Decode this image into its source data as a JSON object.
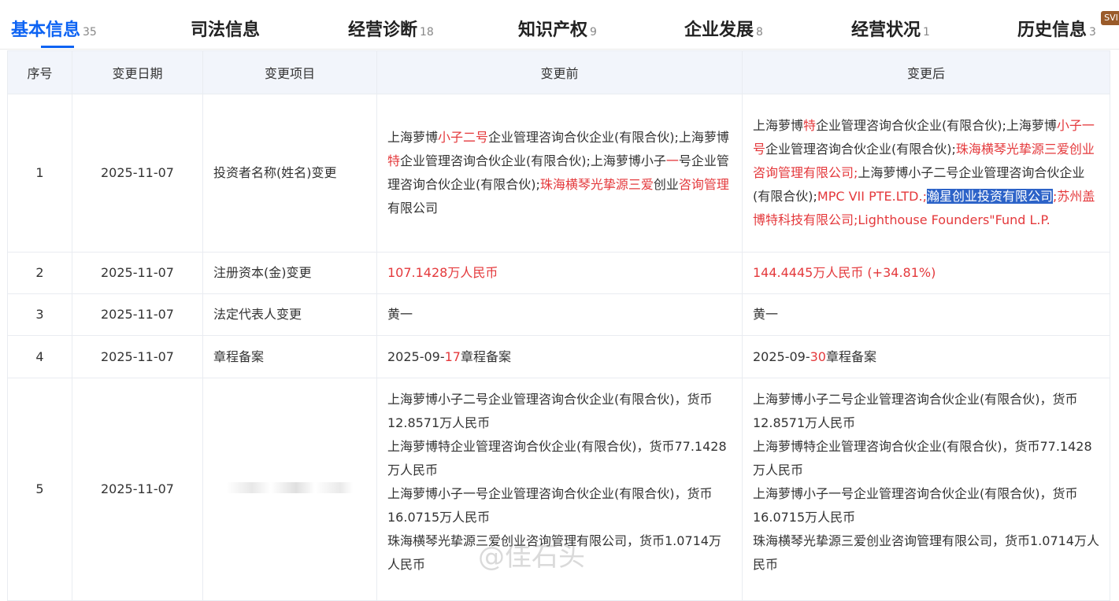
{
  "tabs": [
    {
      "label": "基本信息",
      "count": "35"
    },
    {
      "label": "司法信息",
      "count": ""
    },
    {
      "label": "经营诊断",
      "count": "18"
    },
    {
      "label": "知识产权",
      "count": "9"
    },
    {
      "label": "企业发展",
      "count": "8"
    },
    {
      "label": "经营状况",
      "count": "1"
    },
    {
      "label": "历史信息",
      "count": "3"
    }
  ],
  "badge": "SVI",
  "table": {
    "headers": [
      "序号",
      "变更日期",
      "变更项目",
      "变更前",
      "变更后"
    ],
    "rows": [
      {
        "index": "1",
        "date": "2025-11-07",
        "item": "投资者名称(姓名)变更",
        "before": {
          "p1": "上海萝博",
          "p2": "小子二号",
          "p3": "企业管理咨询合伙企业(有限合伙);上海萝博",
          "p4": "特",
          "p5": "企业管理咨询合伙企业(有限合伙);上海萝博小子",
          "p6": "一",
          "p7": "号企业管理咨询合伙企业(有限合伙);",
          "p8": "珠海横琴光挚源三爱",
          "p9": "创业",
          "p10": "咨询管理",
          "p11": "有限公司"
        },
        "after": {
          "p1": "上海萝博",
          "p2": "特",
          "p3": "企业管理咨询合伙企业(有限合伙);上海萝博",
          "p4": "小子一号",
          "p5": "企业管理咨询合伙企业(有限合伙);",
          "p6": "珠海横琴光挚源三爱创业咨询管理有限公司;",
          "p7": "上海萝博小子二号企业管理咨询合伙企业(有限合伙);",
          "p8": "MPC VII PTE.LTD.;",
          "p9": "瀚星创业投资有限公司",
          "p10": ";苏州盖博特科技有限公司;Lighthouse Founders\"Fund L.P."
        }
      },
      {
        "index": "2",
        "date": "2025-11-07",
        "item": "注册资本(金)变更",
        "before": "107.1428万人民币",
        "after": "144.4445万人民币 (+34.81%)"
      },
      {
        "index": "3",
        "date": "2025-11-07",
        "item": "法定代表人变更",
        "before": "黄一",
        "after": "黄一"
      },
      {
        "index": "4",
        "date": "2025-11-07",
        "item": "章程备案",
        "before": {
          "p1": "2025-09-",
          "p2": "17",
          "p3": "章程备案"
        },
        "after": {
          "p1": "2025-09-",
          "p2": "30",
          "p3": "章程备案"
        }
      },
      {
        "index": "5",
        "date": "2025-11-07",
        "before": [
          "上海萝博小子二号企业管理咨询合伙企业(有限合伙)，货币12.8571万人民币",
          "上海萝博特企业管理咨询合伙企业(有限合伙)，货币77.1428万人民币",
          "上海萝博小子一号企业管理咨询合伙企业(有限合伙)，货币16.0715万人民币",
          "珠海横琴光挚源三爱创业咨询管理有限公司，货币1.0714万人民币"
        ],
        "after": [
          "上海萝博小子二号企业管理咨询合伙企业(有限合伙)，货币12.8571万人民币",
          "上海萝博特企业管理咨询合伙企业(有限合伙)，货币77.1428万人民币",
          "上海萝博小子一号企业管理咨询合伙企业(有限合伙)，货币16.0715万人民币",
          "珠海横琴光挚源三爱创业咨询管理有限公司，货币1.0714万人民币"
        ]
      }
    ]
  },
  "watermark": "@佳石头",
  "colors": {
    "accent": "#0d63f3",
    "highlight_red": "#e4393c",
    "header_bg": "#f2f5fb",
    "selection": "#2d63c8"
  }
}
